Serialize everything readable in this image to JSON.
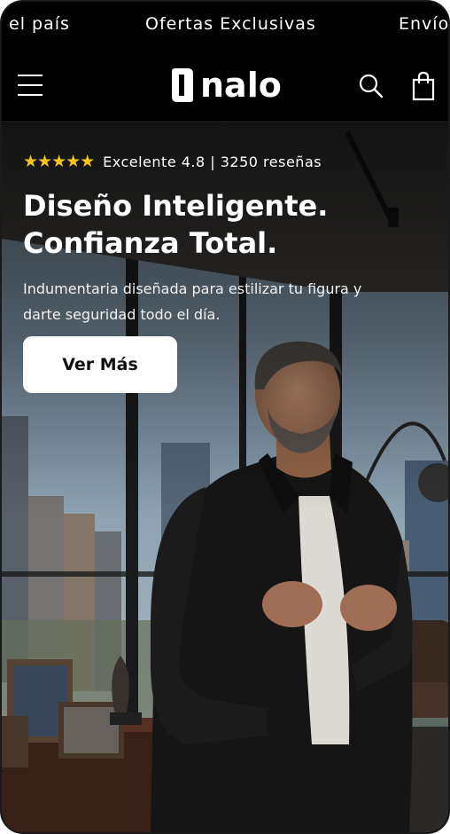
{
  "announcement": {
    "items": [
      "el país",
      "Ofertas Exclusivas",
      "Envío"
    ]
  },
  "header": {
    "brand": "nalo",
    "menu_icon": "hamburger-menu-icon",
    "search_icon": "search-icon",
    "cart_icon": "shopping-bag-icon"
  },
  "hero": {
    "stars": "★★★★★",
    "rating_text": "Excelente 4.8 | 3250 reseñas",
    "headline_line1": "Diseño Inteligente.",
    "headline_line2": "Confianza Total.",
    "subtext_line1": "Indumentaria diseñada para estilizar tu figura y",
    "subtext_line2": "darte seguridad todo el día.",
    "cta_label": "Ver Más"
  },
  "colors": {
    "background": "#000000",
    "text": "#ffffff",
    "star": "#f5c518",
    "button_bg": "#ffffff",
    "button_text": "#111111"
  }
}
